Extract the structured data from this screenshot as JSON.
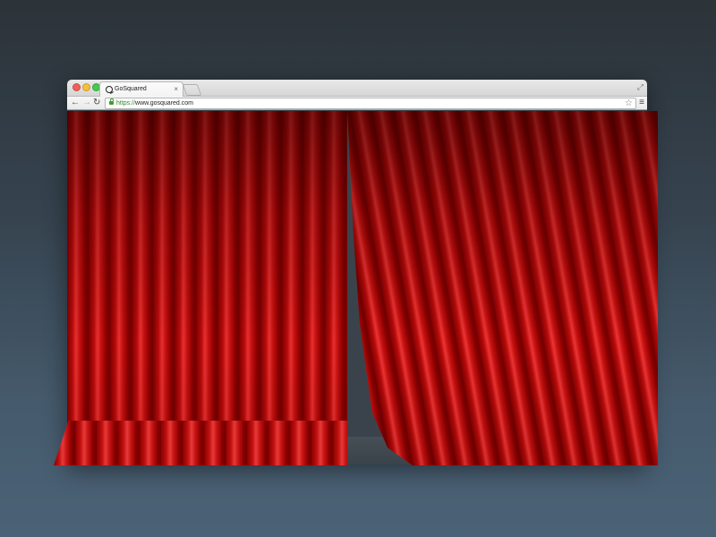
{
  "browser": {
    "tab": {
      "title": "GoSquared",
      "close_glyph": "×",
      "favicon": "gosquared-logo-icon"
    },
    "toolbar": {
      "back_glyph": "←",
      "forward_glyph": "→",
      "reload_glyph": "↻",
      "url_scheme": "https://",
      "url_host": "www.gosquared.com",
      "bookmark_glyph": "☆",
      "menu_glyph": "≡"
    },
    "window_controls": {
      "fullscreen_glyph": "⤢"
    }
  },
  "colors": {
    "curtain_red": "#c01010",
    "curtain_dark": "#6e0000",
    "background_top": "#2c3339",
    "background_bottom": "#4b6276"
  }
}
